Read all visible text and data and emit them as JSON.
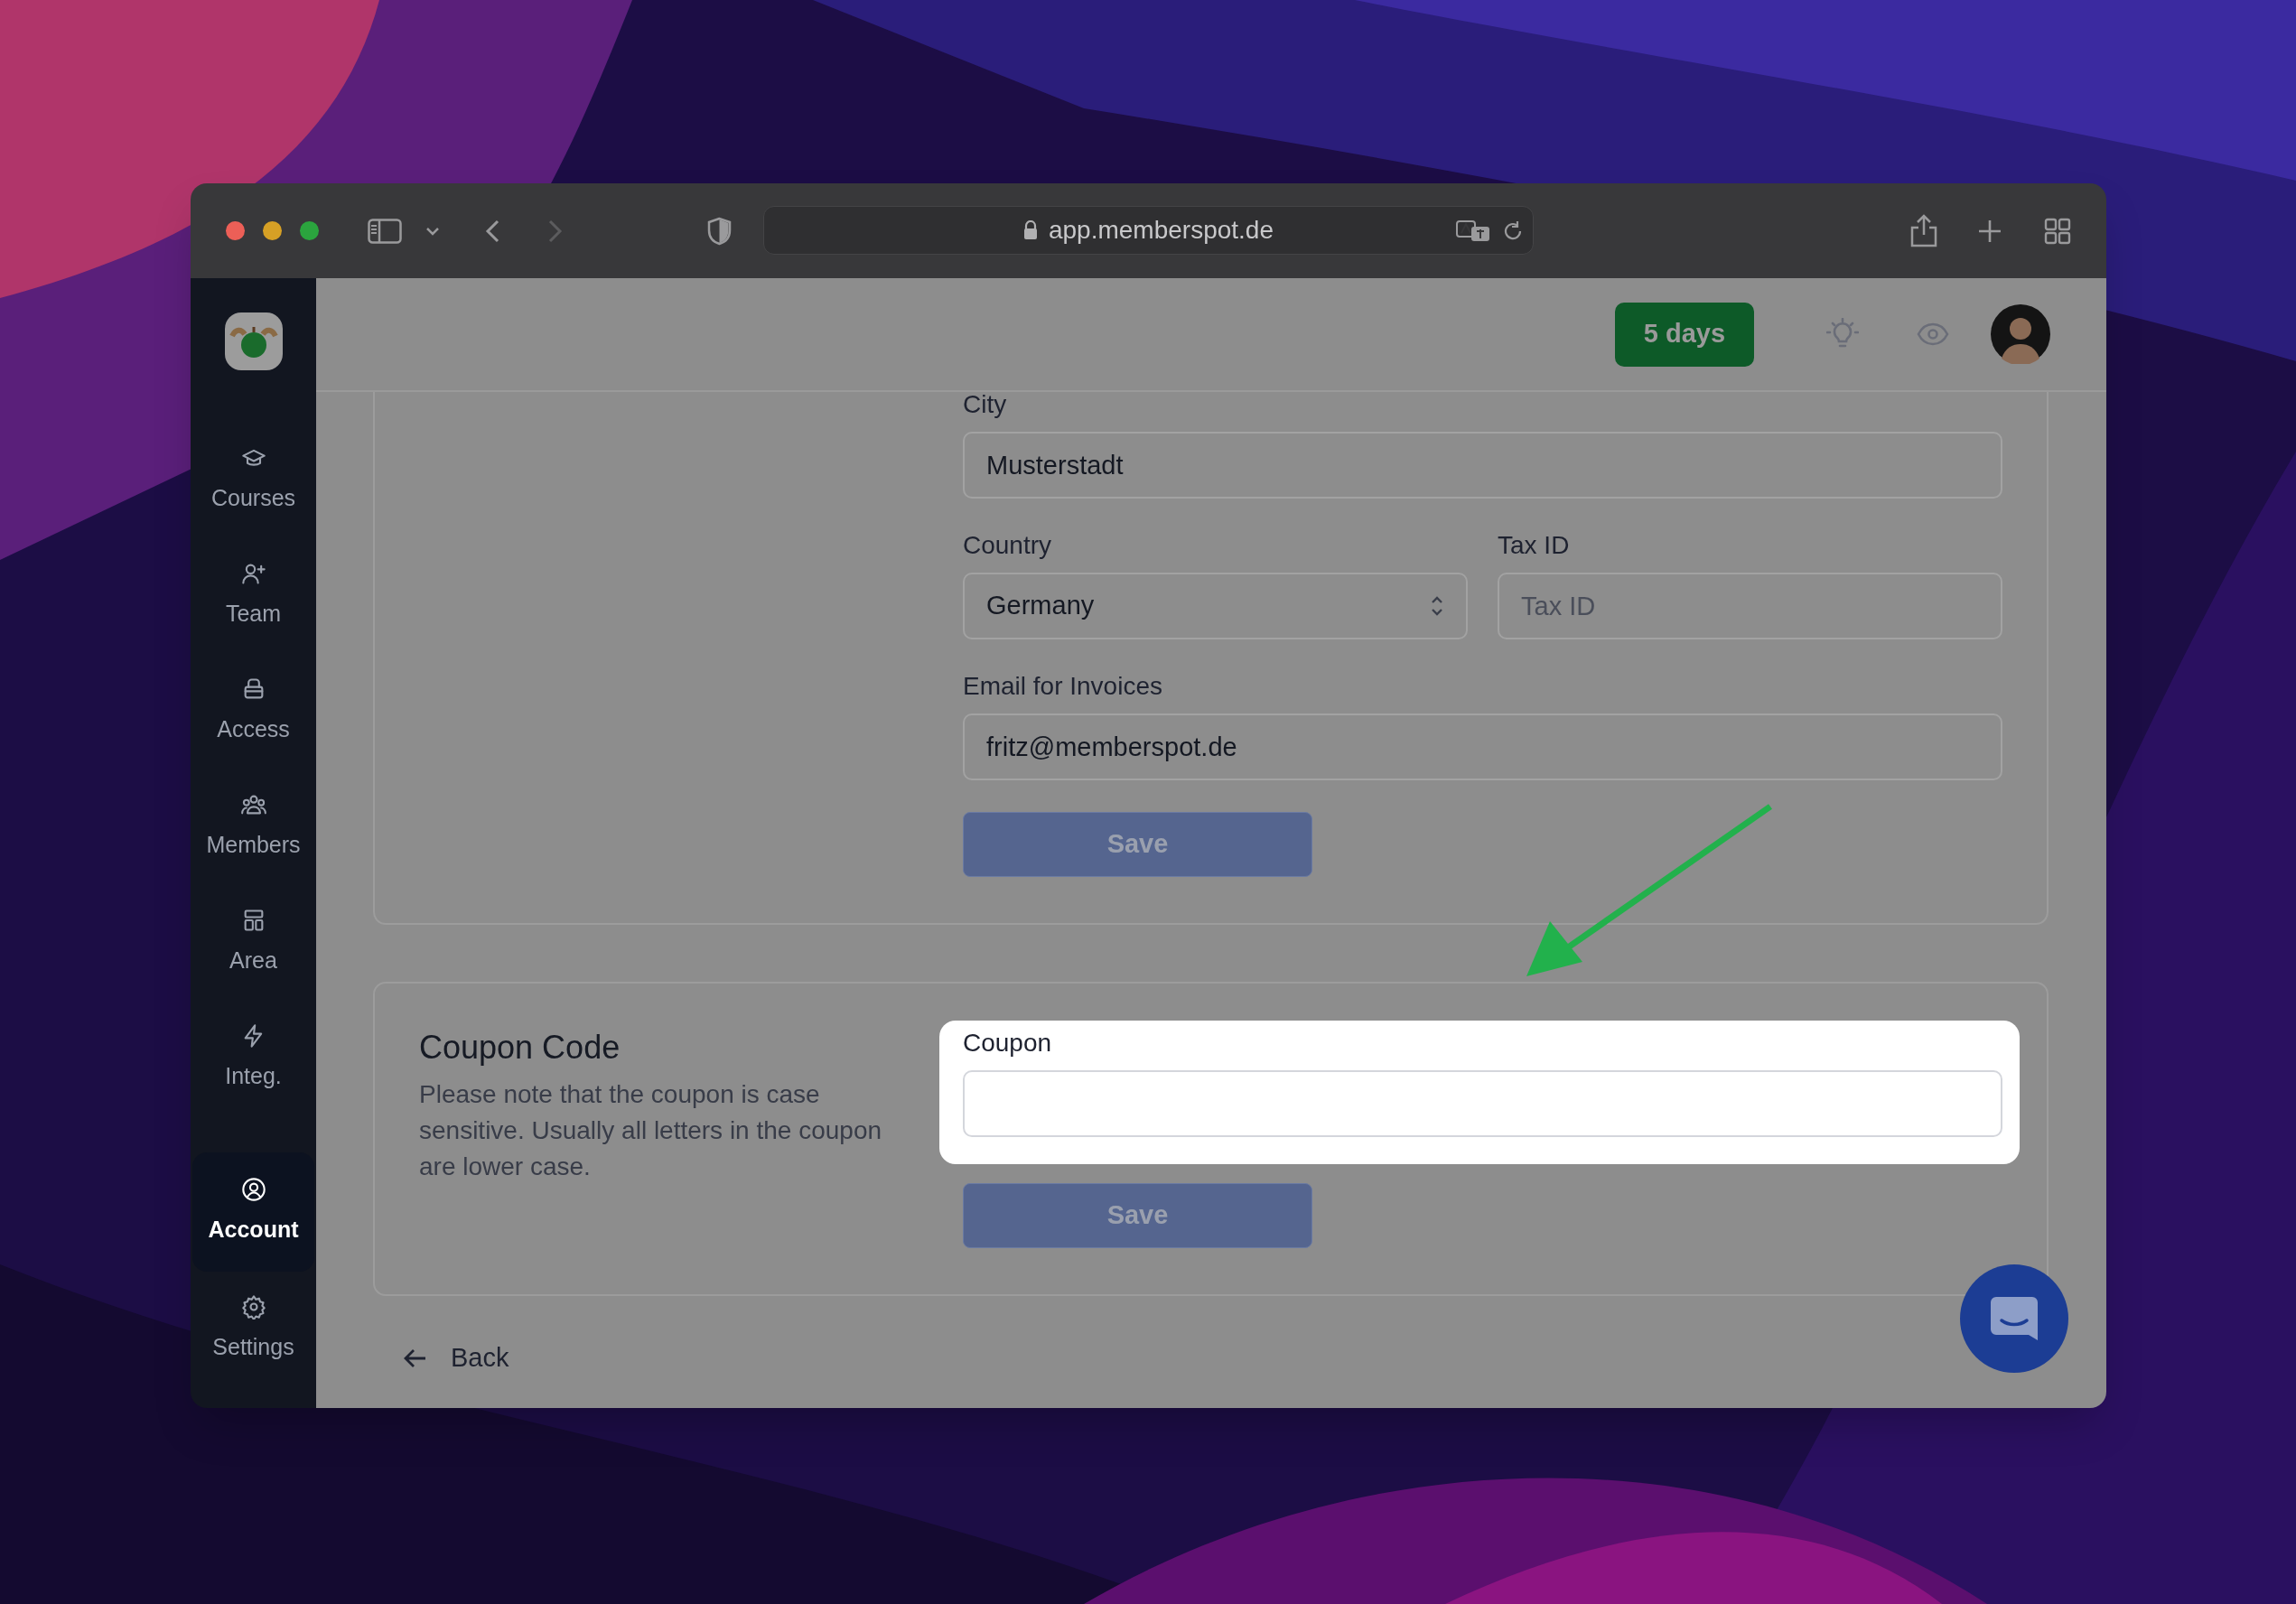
{
  "browser": {
    "url": "app.memberspot.de"
  },
  "sidebar": {
    "items": [
      {
        "label": "Courses",
        "selected": false
      },
      {
        "label": "Team",
        "selected": false
      },
      {
        "label": "Access",
        "selected": false
      },
      {
        "label": "Members",
        "selected": false
      },
      {
        "label": "Area",
        "selected": false
      },
      {
        "label": "Integ.",
        "selected": false
      },
      {
        "label": "Account",
        "selected": true
      },
      {
        "label": "Settings",
        "selected": false
      }
    ]
  },
  "header": {
    "trial_badge": "5 days"
  },
  "billing_form": {
    "rows": [
      {
        "fields": [
          {
            "label": "City",
            "kind": "input",
            "value": "Musterstadt"
          }
        ]
      },
      {
        "fields": [
          {
            "label": "Country",
            "kind": "select",
            "value": "Germany"
          },
          {
            "label": "Tax ID",
            "kind": "input",
            "placeholder": "Tax ID"
          }
        ]
      },
      {
        "fields": [
          {
            "label": "Email for Invoices",
            "kind": "input",
            "value": "fritz@memberspot.de"
          }
        ]
      }
    ],
    "save_button": "Save"
  },
  "coupon_section": {
    "title": "Coupon Code",
    "description": "Please note that the coupon is case sensitive. Usually all letters in the coupon are lower case.",
    "field": {
      "label": "Coupon"
    },
    "highlighted": true,
    "save_button": "Save"
  },
  "back_link": "Back"
}
